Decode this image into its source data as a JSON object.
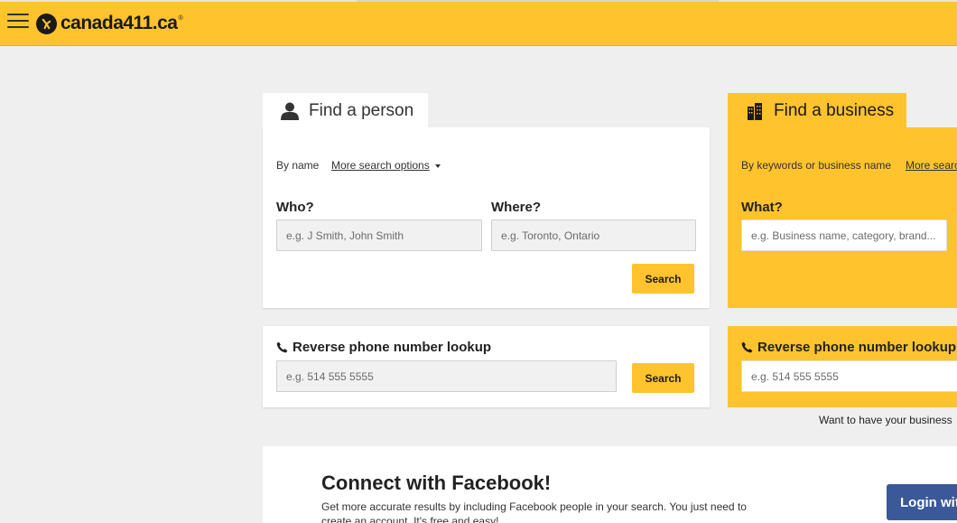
{
  "header": {
    "logo_text": "canada411.ca",
    "logo_reg": "®",
    "logo_icon": "walking-fingers-icon",
    "menu_icon": "hamburger-icon"
  },
  "person": {
    "tab_label": "Find a person",
    "tab_icon": "person-icon",
    "by_label": "By name",
    "more_options": "More search options",
    "who_label": "Who?",
    "who_placeholder": "e.g. J Smith, John Smith",
    "where_label": "Where?",
    "where_placeholder": "e.g. Toronto, Ontario",
    "search_label": "Search"
  },
  "business": {
    "tab_label": "Find a business",
    "tab_icon": "buildings-icon",
    "by_label": "By keywords or business name",
    "more_options": "More search options",
    "what_label": "What?",
    "what_placeholder": "e.g. Business name, category, brand..."
  },
  "reverse_person": {
    "title": "Reverse phone number lookup",
    "placeholder": "e.g. 514 555 5555",
    "search_label": "Search",
    "icon": "phone-icon"
  },
  "reverse_business": {
    "title": "Reverse phone number lookup",
    "placeholder": "e.g. 514 555 5555",
    "icon": "phone-icon"
  },
  "want_text": "Want to have your business",
  "facebook": {
    "title": "Connect with Facebook!",
    "text": "Get more accurate results by including Facebook people in your search. You just need to create an account. It's free and easy!",
    "login_label": "Login with Facebook"
  },
  "colors": {
    "brand_yellow": "#fec32d",
    "facebook_blue": "#3b5998"
  }
}
